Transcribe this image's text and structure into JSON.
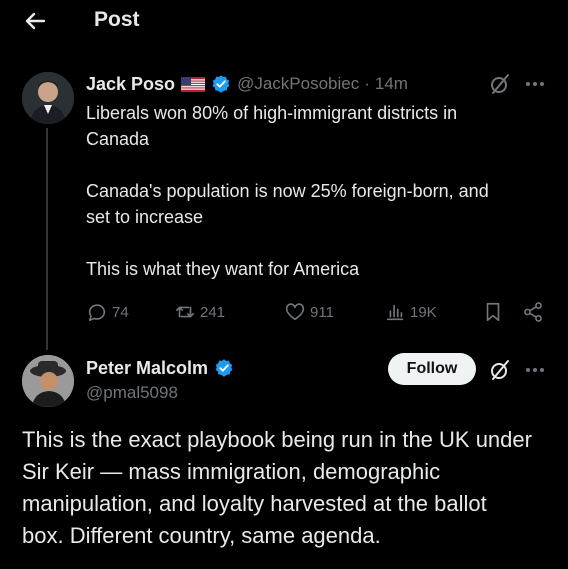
{
  "header": {
    "back_icon": "arrow-left-icon",
    "title": "Post"
  },
  "tweet": {
    "author": {
      "display_name": "Jack Poso",
      "flag_icon": "us-flag-icon",
      "verified_icon": "verified-badge-icon",
      "handle": "@JackPosobiec",
      "separator": "·",
      "time": "14m"
    },
    "lines": [
      "Liberals won 80% of high-immigrant districts in",
      "Canada",
      "Canada's population is now 25% foreign-born, and",
      "set to increase",
      "This is what they want for America"
    ],
    "actions": {
      "replies": "74",
      "reposts": "241",
      "likes": "911",
      "views": "19K"
    }
  },
  "reply": {
    "author": {
      "display_name": "Peter Malcolm",
      "handle": "@pmal5098"
    },
    "follow_label": "Follow",
    "lines": [
      "This is the exact playbook being run in the UK under",
      "Sir Keir — mass immigration, demographic",
      "manipulation, and loyalty harvested at the ballot",
      "box. Different country, same agenda."
    ]
  },
  "colors": {
    "background": "#000000",
    "text": "#e7e9ea",
    "muted": "#71767b",
    "verified": "#1d9bf0",
    "follow_bg": "#eff3f4"
  }
}
